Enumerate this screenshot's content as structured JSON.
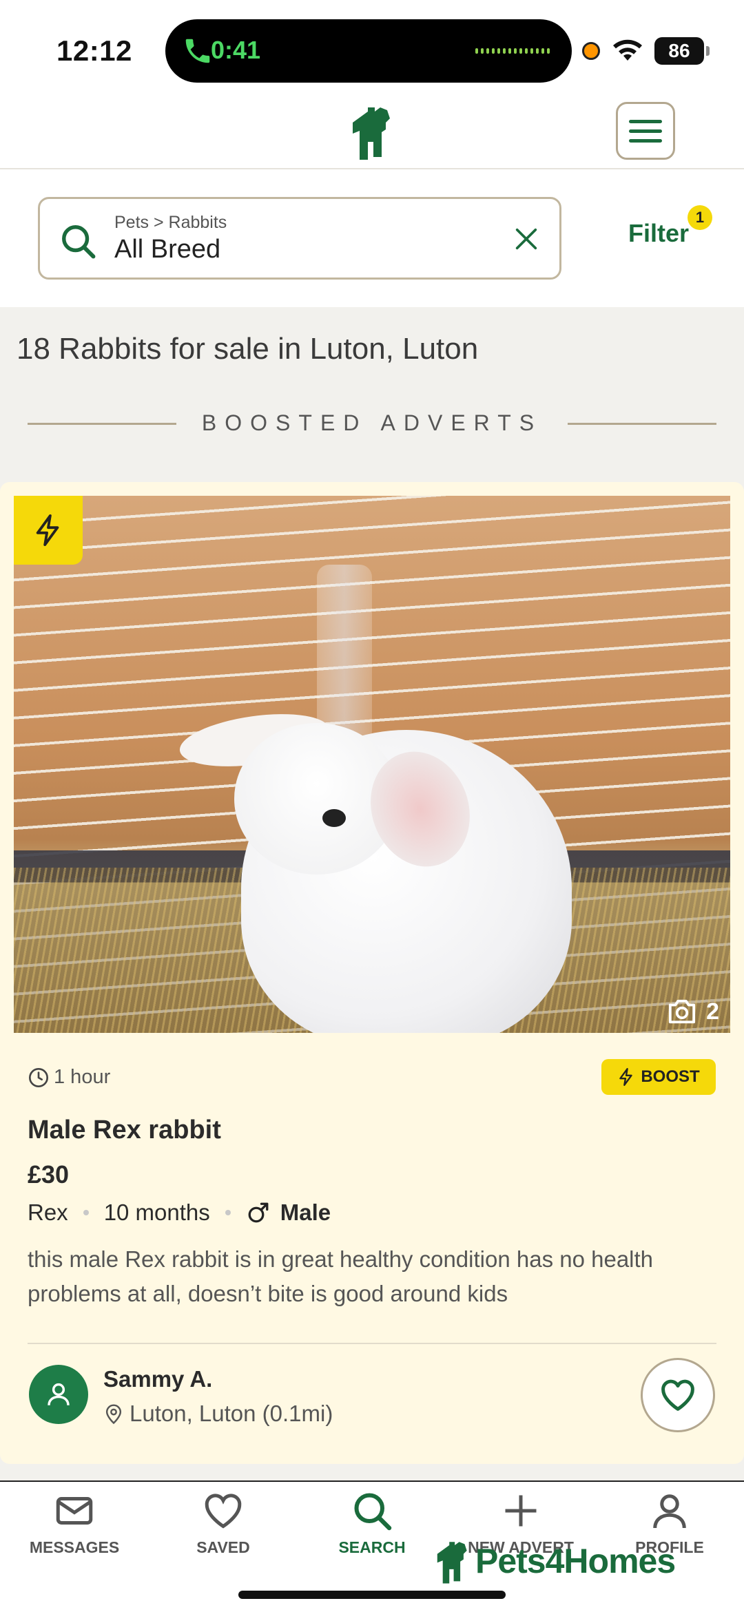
{
  "status_bar": {
    "time": "12:12",
    "call_timer": "0:41",
    "battery": "86"
  },
  "search": {
    "breadcrumb": "Pets > Rabbits",
    "value": "All Breed",
    "filter_label": "Filter",
    "filter_count": "1"
  },
  "results": {
    "title": "18 Rabbits for sale in Luton, Luton",
    "boosted_label": "BOOSTED ADVERTS"
  },
  "card": {
    "photo_count": "2",
    "posted": "1 hour",
    "boost_label": "BOOST",
    "title": "Male Rex rabbit",
    "price": "£30",
    "breed": "Rex",
    "age": "10 months",
    "gender": "Male",
    "description": "this male Rex rabbit is in great healthy condition has no health problems at all, doesn’t bite is good around kids",
    "seller_name": "Sammy A.",
    "seller_location": "Luton, Luton (0.1mi)"
  },
  "nav": {
    "items": [
      {
        "label": "MESSAGES",
        "icon": "mail-icon"
      },
      {
        "label": "SAVED",
        "icon": "heart-icon"
      },
      {
        "label": "SEARCH",
        "icon": "search-icon"
      },
      {
        "label": "NEW ADVERT",
        "icon": "plus-icon"
      },
      {
        "label": "PROFILE",
        "icon": "person-icon"
      }
    ],
    "active": "SEARCH"
  },
  "brand": {
    "name": "Pets4Homes"
  },
  "colors": {
    "brand_green": "#1a6b3c",
    "boost_yellow": "#f5d90a",
    "card_background": "#fff9e3",
    "border_tan": "#b3a78f"
  }
}
